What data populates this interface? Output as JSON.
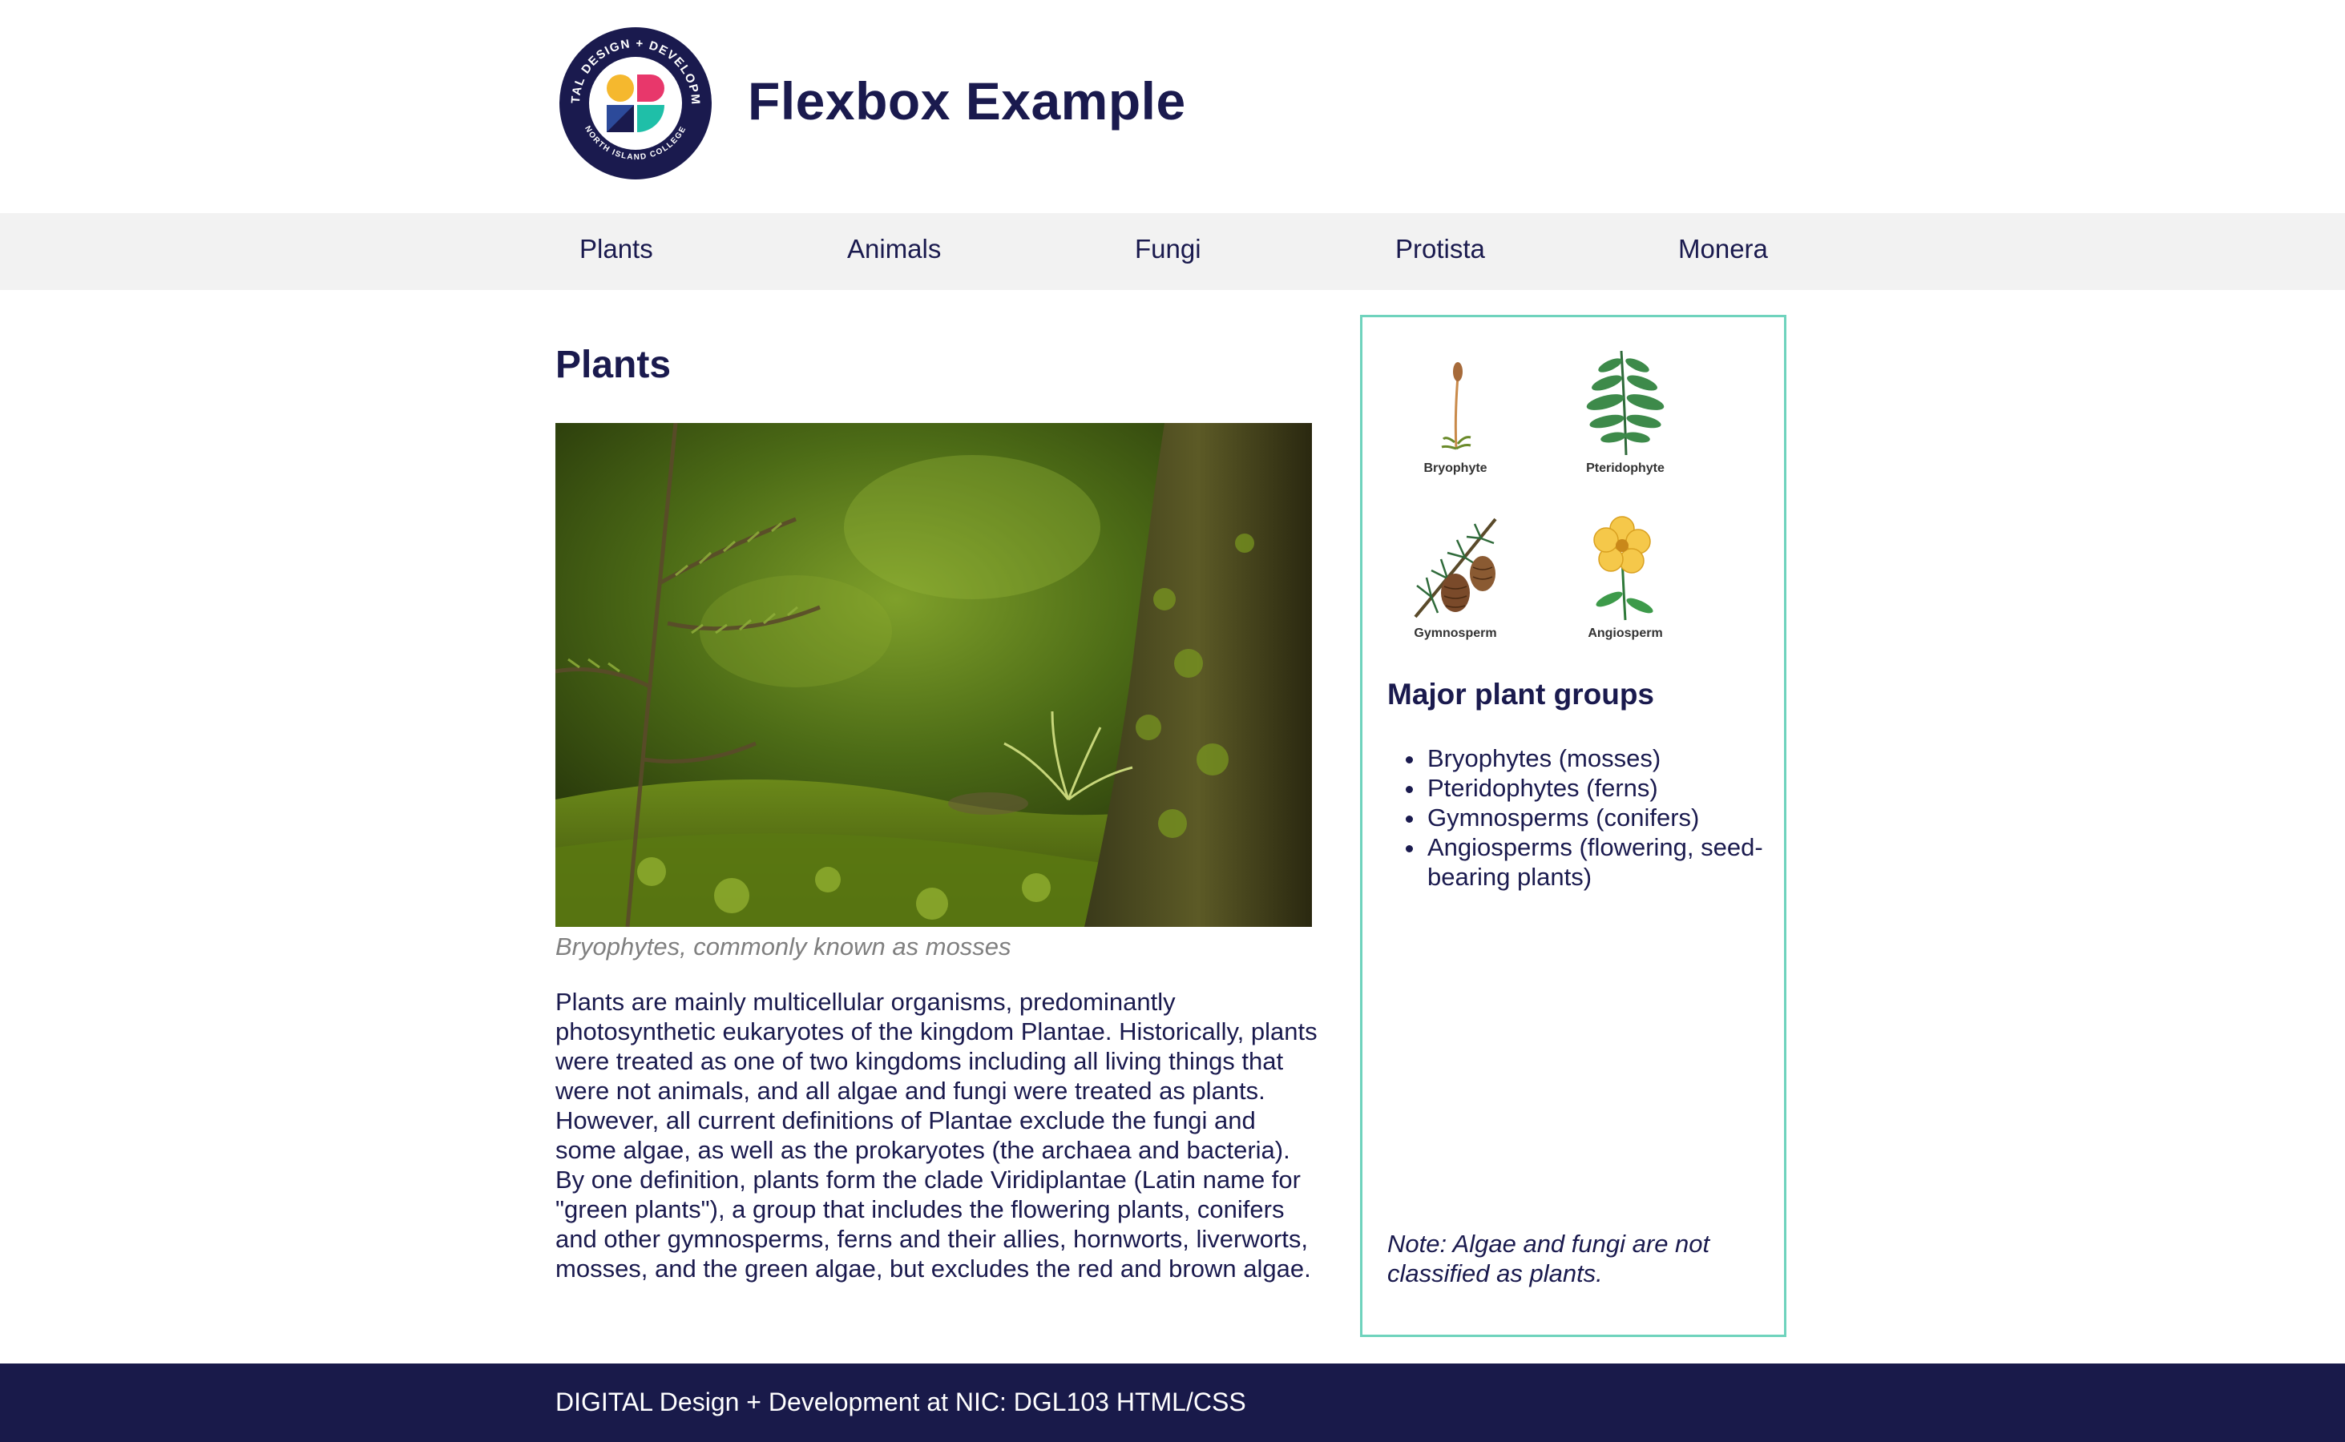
{
  "header": {
    "title": "Flexbox Example",
    "logo": {
      "ring_top_text": "DIGITAL DESIGN + DEVELOPMENT",
      "ring_bottom_text": "NORTH ISLAND COLLEGE",
      "colors": {
        "ring": "#1a1a4e",
        "yellow": "#f5b82e",
        "pink": "#e8376b",
        "navy": "#1a1a4e",
        "teal": "#1fbfa8"
      }
    }
  },
  "nav": {
    "items": [
      {
        "label": "Plants"
      },
      {
        "label": "Animals"
      },
      {
        "label": "Fungi"
      },
      {
        "label": "Protista"
      },
      {
        "label": "Monera"
      }
    ]
  },
  "main": {
    "title": "Plants",
    "image_caption": "Bryophytes, commonly known as mosses",
    "body": "Plants are mainly multicellular organisms, predominantly photosynthetic eukaryotes of the kingdom Plantae. Historically, plants were treated as one of two kingdoms including all living things that were not animals, and all algae and fungi were treated as plants. However, all current definitions of Plantae exclude the fungi and some algae, as well as the prokaryotes (the archaea and bacteria). By one definition, plants form the clade Viridiplantae (Latin name for \"green plants\"), a group that includes the flowering plants, conifers and other gymnosperms, ferns and their allies, hornworts, liverworts, mosses, and the green algae, but excludes the red and brown algae."
  },
  "aside": {
    "plant_types": [
      {
        "label": "Bryophyte",
        "icon": "moss-icon"
      },
      {
        "label": "Pteridophyte",
        "icon": "fern-icon"
      },
      {
        "label": "Gymnosperm",
        "icon": "pinecone-icon"
      },
      {
        "label": "Angiosperm",
        "icon": "flower-icon"
      }
    ],
    "title": "Major plant groups",
    "groups": [
      "Bryophytes (mosses)",
      "Pteridophytes (ferns)",
      "Gymnosperms (conifers)",
      "Angiosperms (flowering, seed-bearing plants)"
    ],
    "note": "Note: Algae and fungi are not classified as plants."
  },
  "footer": {
    "text": "DIGITAL Design + Development at NIC: DGL103 HTML/CSS"
  },
  "colors": {
    "brand_navy": "#1a1a4e",
    "nav_bg": "#f2f2f2",
    "aside_border": "#6fd3bd",
    "caption_gray": "#808080",
    "footer_bg": "#191a4a"
  }
}
